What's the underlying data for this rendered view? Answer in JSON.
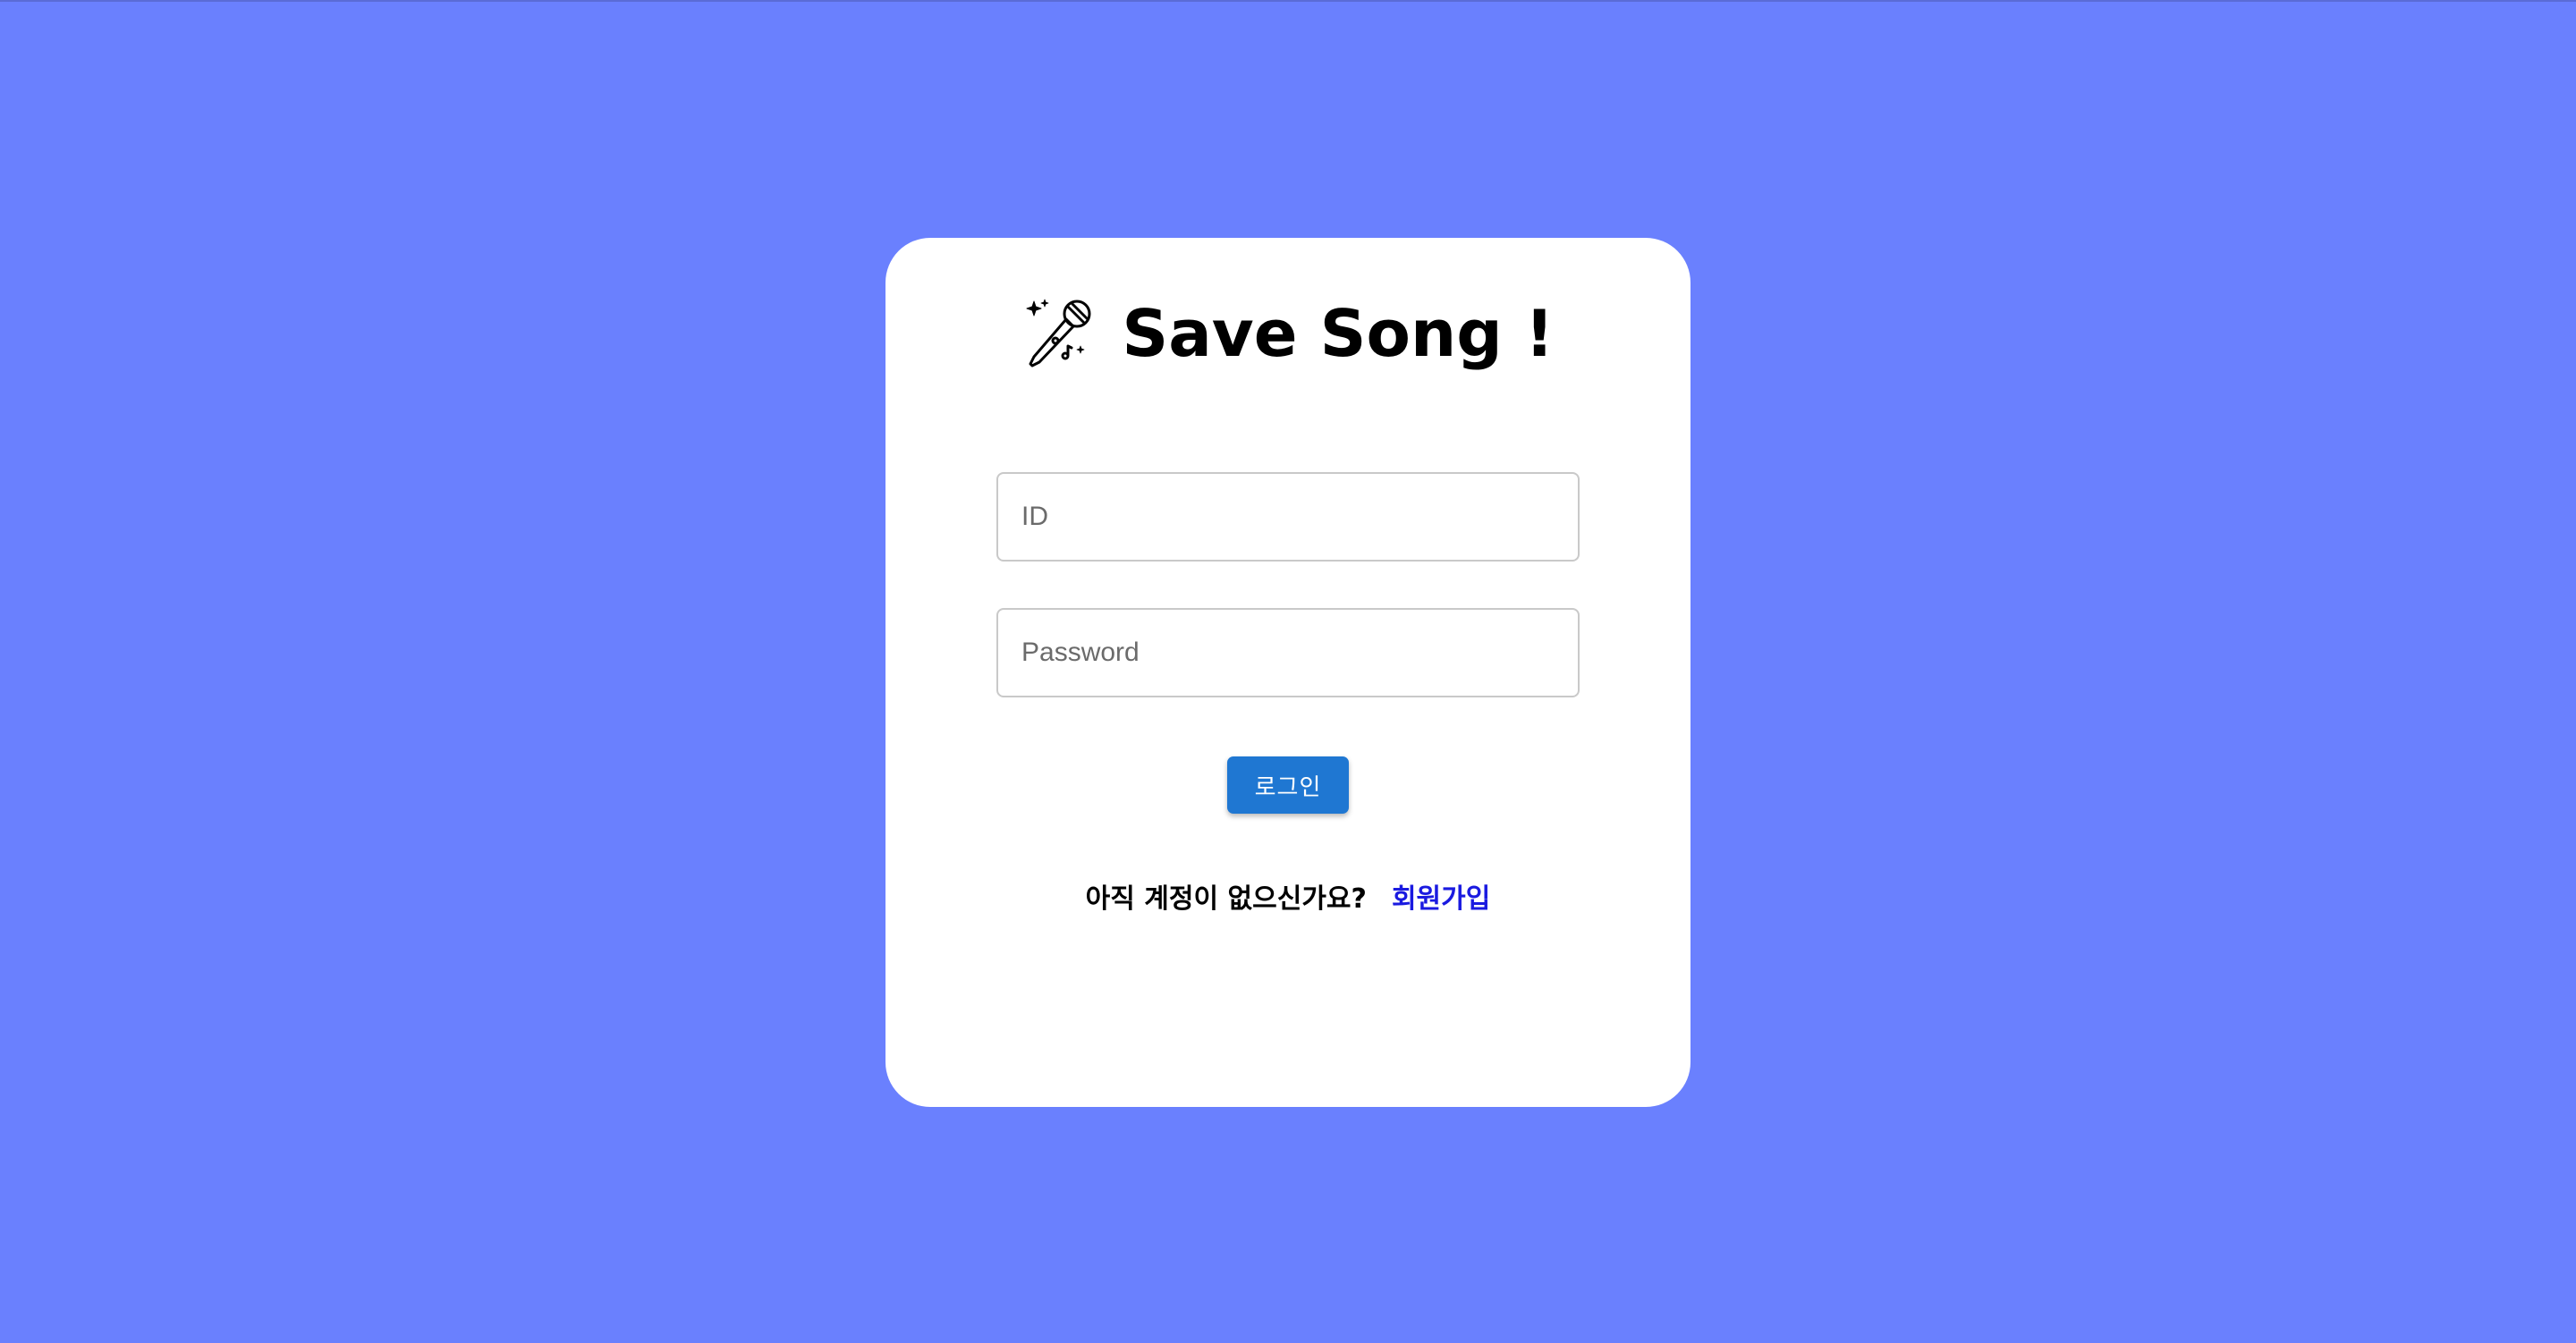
{
  "header": {
    "logo_icon": "microphone-sparkle-icon",
    "title": "Save Song !"
  },
  "form": {
    "id_placeholder": "ID",
    "password_placeholder": "Password",
    "login_label": "로그인"
  },
  "signup": {
    "prompt": "아직 계정이 없으신가요?",
    "link_label": "회원가입"
  },
  "colors": {
    "background": "#6a80fe",
    "card": "#ffffff",
    "button": "#1f77d2",
    "link": "#1a1ae0"
  }
}
